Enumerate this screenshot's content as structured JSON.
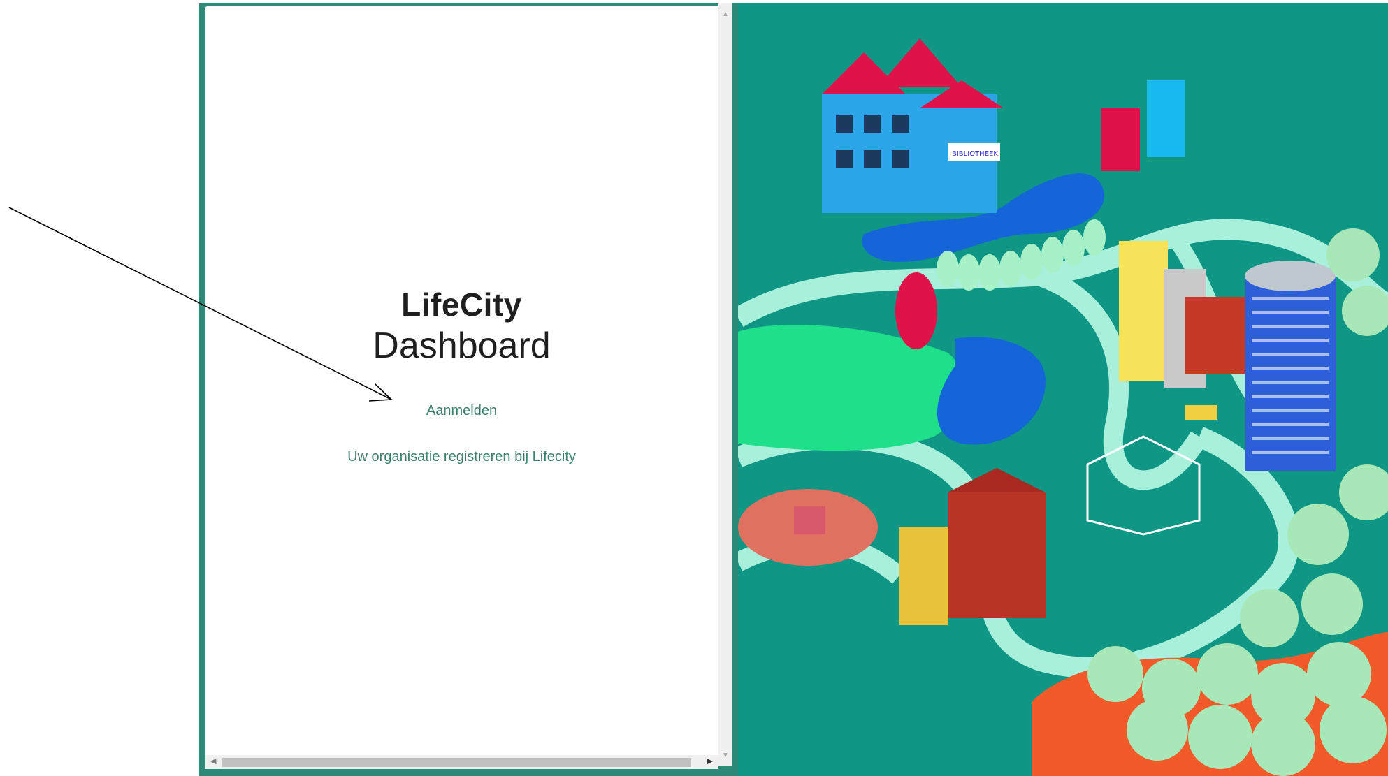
{
  "brand": {
    "title": "LifeCity",
    "subtitle": "Dashboard"
  },
  "actions": {
    "signin_label": "Aanmelden",
    "register_label": "Uw organisatie registreren bij Lifecity"
  },
  "illustration": {
    "library_sign": "BIBLIOTHEEK"
  },
  "colors": {
    "background_teal": "#0f9684",
    "link_color": "#3d7f6f",
    "road": "#a8f0dc",
    "water": "#1466d8",
    "grass": "#1fe08a"
  },
  "icons": {
    "annotation": "arrow-annotation-icon"
  }
}
